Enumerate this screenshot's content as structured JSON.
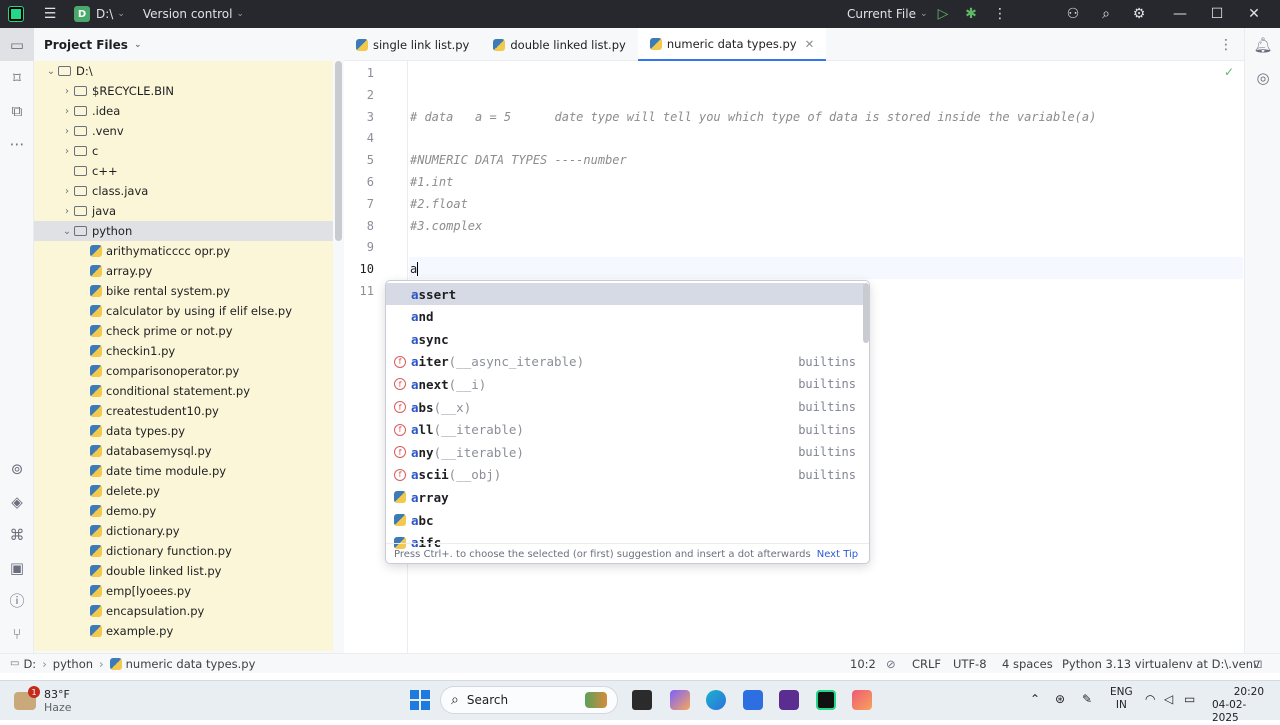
{
  "titlebar": {
    "project_badge": "D",
    "project_name": "D:\\",
    "vcs": "Version control",
    "run_config": "Current File"
  },
  "project_panel": {
    "title": "Project Files",
    "tree": [
      {
        "label": "D:\\",
        "level": 0,
        "expanded": true,
        "type": "folder"
      },
      {
        "label": "$RECYCLE.BIN",
        "level": 1,
        "expanded": false,
        "type": "folder"
      },
      {
        "label": ".idea",
        "level": 1,
        "expanded": false,
        "type": "folder"
      },
      {
        "label": ".venv",
        "level": 1,
        "expanded": false,
        "type": "folder"
      },
      {
        "label": "c",
        "level": 1,
        "expanded": false,
        "type": "folder"
      },
      {
        "label": "c++",
        "level": 1,
        "expanded": null,
        "type": "folder"
      },
      {
        "label": "class.java",
        "level": 1,
        "expanded": false,
        "type": "folder"
      },
      {
        "label": "java",
        "level": 1,
        "expanded": false,
        "type": "folder"
      },
      {
        "label": "python",
        "level": 1,
        "expanded": true,
        "type": "folder",
        "selected": true
      },
      {
        "label": "arithymaticccc opr.py",
        "level": 2,
        "type": "py"
      },
      {
        "label": "array.py",
        "level": 2,
        "type": "py"
      },
      {
        "label": "bike rental system.py",
        "level": 2,
        "type": "py"
      },
      {
        "label": "calculator by using if elif else.py",
        "level": 2,
        "type": "py"
      },
      {
        "label": "check prime or not.py",
        "level": 2,
        "type": "py"
      },
      {
        "label": "checkin1.py",
        "level": 2,
        "type": "py"
      },
      {
        "label": "comparisonoperator.py",
        "level": 2,
        "type": "py"
      },
      {
        "label": "conditional statement.py",
        "level": 2,
        "type": "py"
      },
      {
        "label": "createstudent10.py",
        "level": 2,
        "type": "py"
      },
      {
        "label": "data types.py",
        "level": 2,
        "type": "py"
      },
      {
        "label": "databasemysql.py",
        "level": 2,
        "type": "py"
      },
      {
        "label": "date time module.py",
        "level": 2,
        "type": "py"
      },
      {
        "label": "delete.py",
        "level": 2,
        "type": "py"
      },
      {
        "label": "demo.py",
        "level": 2,
        "type": "py"
      },
      {
        "label": "dictionary.py",
        "level": 2,
        "type": "py"
      },
      {
        "label": "dictionary function.py",
        "level": 2,
        "type": "py"
      },
      {
        "label": "double linked list.py",
        "level": 2,
        "type": "py"
      },
      {
        "label": "emp[lyoees.py",
        "level": 2,
        "type": "py"
      },
      {
        "label": "encapsulation.py",
        "level": 2,
        "type": "py"
      },
      {
        "label": "example.py",
        "level": 2,
        "type": "py"
      }
    ]
  },
  "tabs": [
    {
      "label": "single link list.py",
      "active": false
    },
    {
      "label": "double linked list.py",
      "active": false
    },
    {
      "label": "numeric data types.py",
      "active": true
    }
  ],
  "editor": {
    "line_numbers": [
      "1",
      "2",
      "3",
      "4",
      "5",
      "6",
      "7",
      "8",
      "9",
      "10",
      "11"
    ],
    "lines": [
      "",
      "",
      "# data   a = 5      date type will tell you which type of data is stored inside the variable(a)",
      "",
      "#NUMERIC DATA TYPES ----number",
      "#1.int",
      "#2.float",
      "#3.complex",
      "",
      "a",
      ""
    ]
  },
  "completion": {
    "items": [
      {
        "hl": "a",
        "rest": "ssert",
        "args": "",
        "source": "",
        "kind": "keyword",
        "selected": true
      },
      {
        "hl": "a",
        "rest": "nd",
        "args": "",
        "source": "",
        "kind": "keyword"
      },
      {
        "hl": "a",
        "rest": "sync",
        "args": "",
        "source": "",
        "kind": "keyword"
      },
      {
        "hl": "a",
        "rest": "iter",
        "args": "(__async_iterable)",
        "source": "builtins",
        "kind": "function"
      },
      {
        "hl": "a",
        "rest": "next",
        "args": "(__i)",
        "source": "builtins",
        "kind": "function"
      },
      {
        "hl": "a",
        "rest": "bs",
        "args": "(__x)",
        "source": "builtins",
        "kind": "function"
      },
      {
        "hl": "a",
        "rest": "ll",
        "args": "(__iterable)",
        "source": "builtins",
        "kind": "function"
      },
      {
        "hl": "a",
        "rest": "ny",
        "args": "(__iterable)",
        "source": "builtins",
        "kind": "function"
      },
      {
        "hl": "a",
        "rest": "scii",
        "args": "(__obj)",
        "source": "builtins",
        "kind": "function"
      },
      {
        "hl": "a",
        "rest": "rray",
        "args": "",
        "source": "",
        "kind": "module"
      },
      {
        "hl": "a",
        "rest": "bc",
        "args": "",
        "source": "",
        "kind": "module"
      },
      {
        "hl": "a",
        "rest": "ifc",
        "args": "",
        "source": "",
        "kind": "module"
      }
    ],
    "footer": "Press Ctrl+. to choose the selected (or first) suggestion and insert a dot afterwards",
    "next_tip": "Next Tip"
  },
  "statusbar": {
    "crumb_drive": "D:",
    "crumb_folder": "python",
    "crumb_file": "numeric data types.py",
    "position": "10:2",
    "line_sep": "CRLF",
    "encoding": "UTF-8",
    "indent": "4 spaces",
    "interpreter": "Python 3.13 virtualenv at D:\\.venv"
  },
  "taskbar": {
    "weather_temp": "83°F",
    "weather_desc": "Haze",
    "weather_badge": "1",
    "search": "Search",
    "lang": "ENG",
    "region": "IN",
    "time": "20:20",
    "date": "04-02-2025"
  }
}
